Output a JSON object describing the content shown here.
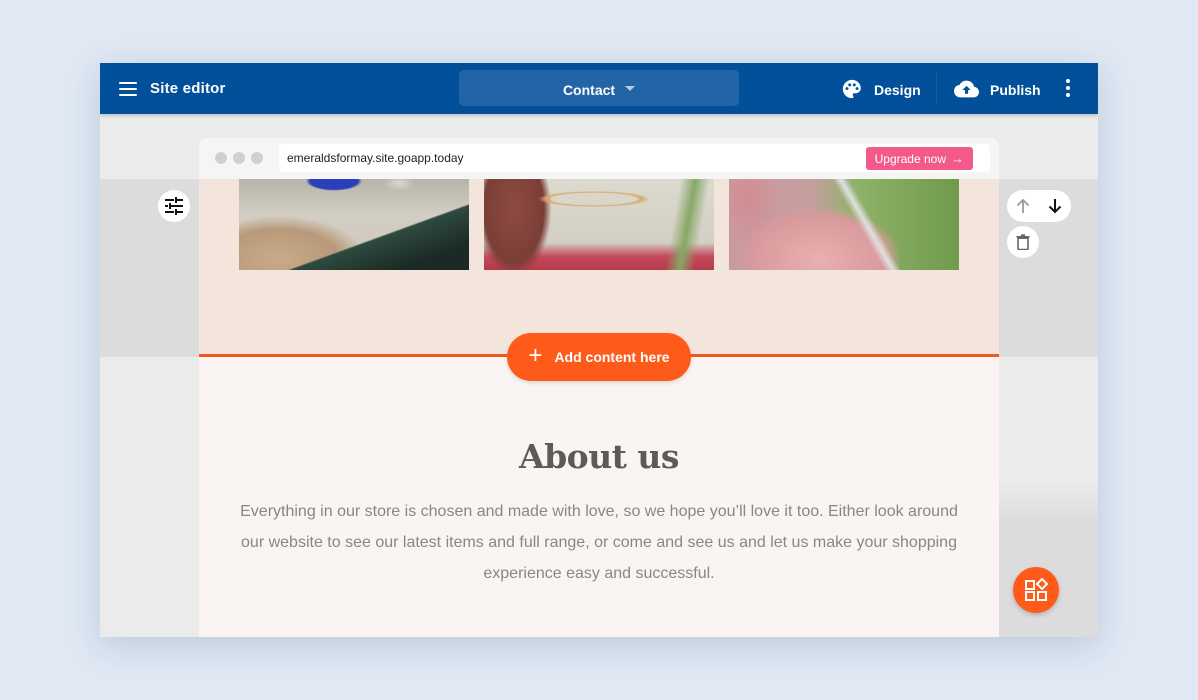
{
  "topbar": {
    "app_title": "Site editor",
    "page_selector": {
      "selected": "Contact"
    },
    "design_label": "Design",
    "publish_label": "Publish",
    "background_color": "#03509a"
  },
  "browser": {
    "url": "emeraldsformay.site.goapp.today",
    "upgrade_label": "Upgrade now",
    "upgrade_arrow": "→",
    "upgrade_color": "#f35a8a"
  },
  "gallery": {
    "photos": [
      {
        "alt": "ring-with-blue-stone"
      },
      {
        "alt": "gold-ring-in-hand"
      },
      {
        "alt": "ring-held-by-fingers"
      }
    ]
  },
  "insert": {
    "icon": "+",
    "label": "Add content here",
    "accent_color": "#fe5b1b"
  },
  "about": {
    "title": "About us",
    "body": "Everything in our store is chosen and made with love, so we hope you’ll love it too. Either look around our website to see our latest items and full range, or come and see us and let us make your shopping experience easy and successful."
  }
}
